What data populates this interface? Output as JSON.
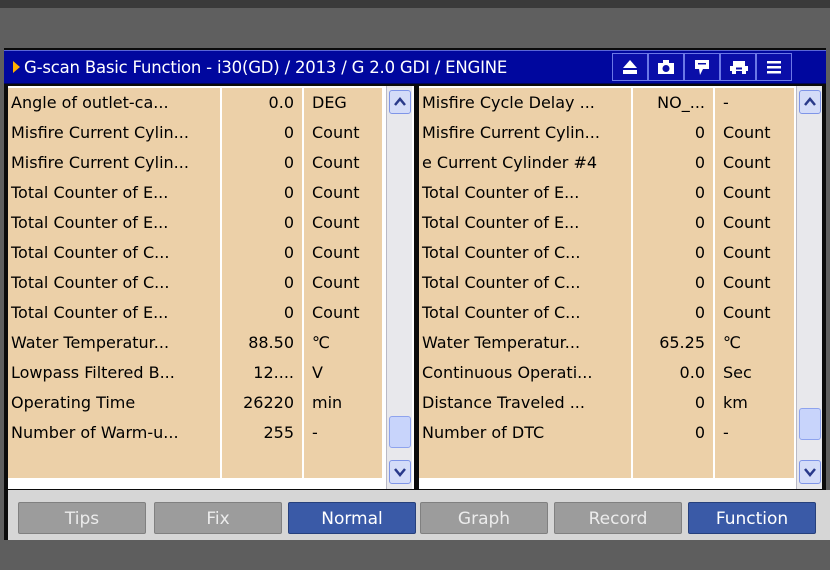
{
  "window": {
    "title": "G-scan Basic Function - i30(GD) / 2013 / G 2.0 GDI / ENGINE"
  },
  "toolbar": {
    "icons": [
      "eject-icon",
      "camera-icon",
      "comment-icon",
      "car-icon",
      "menu-icon"
    ]
  },
  "left_table": {
    "rows": [
      {
        "name": "Angle of outlet-ca...",
        "value": "0.0",
        "unit": "DEG"
      },
      {
        "name": "Misfire Current Cylin...",
        "value": "0",
        "unit": "Count"
      },
      {
        "name": "Misfire Current Cylin...",
        "value": "0",
        "unit": "Count"
      },
      {
        "name": "Total Counter of E...",
        "value": "0",
        "unit": "Count"
      },
      {
        "name": "Total Counter of E...",
        "value": "0",
        "unit": "Count"
      },
      {
        "name": "Total Counter of C...",
        "value": "0",
        "unit": "Count"
      },
      {
        "name": "Total Counter of C...",
        "value": "0",
        "unit": "Count"
      },
      {
        "name": "Total Counter of E...",
        "value": "0",
        "unit": "Count"
      },
      {
        "name": "Water Temperatur...",
        "value": "88.50",
        "unit": "℃"
      },
      {
        "name": "Lowpass Filtered B...",
        "value": "12....",
        "unit": "V"
      },
      {
        "name": "Operating Time",
        "value": "26220",
        "unit": "min"
      },
      {
        "name": "Number of Warm-u...",
        "value": "255",
        "unit": "-"
      },
      {
        "name": "",
        "value": "",
        "unit": ""
      }
    ]
  },
  "right_table": {
    "rows": [
      {
        "name": "Misfire Cycle Delay ...",
        "value": "NO_...",
        "unit": "-"
      },
      {
        "name": "Misfire Current Cylin...",
        "value": "0",
        "unit": "Count"
      },
      {
        "name": "e Current Cylinder #4",
        "value": "0",
        "unit": "Count"
      },
      {
        "name": "Total Counter of E...",
        "value": "0",
        "unit": "Count"
      },
      {
        "name": "Total Counter of E...",
        "value": "0",
        "unit": "Count"
      },
      {
        "name": "Total Counter of C...",
        "value": "0",
        "unit": "Count"
      },
      {
        "name": "Total Counter of C...",
        "value": "0",
        "unit": "Count"
      },
      {
        "name": "Total Counter of C...",
        "value": "0",
        "unit": "Count"
      },
      {
        "name": "Water Temperatur...",
        "value": "65.25",
        "unit": "℃"
      },
      {
        "name": "Continuous Operati...",
        "value": "0.0",
        "unit": "Sec"
      },
      {
        "name": "Distance Traveled ...",
        "value": "0",
        "unit": "km"
      },
      {
        "name": "Number of DTC",
        "value": "0",
        "unit": "-"
      },
      {
        "name": "",
        "value": "",
        "unit": ""
      }
    ]
  },
  "buttons": {
    "tips": "Tips",
    "fix": "Fix",
    "normal": "Normal",
    "graph": "Graph",
    "record": "Record",
    "function": "Function"
  },
  "colors": {
    "title_bg": "#00079e",
    "row_bg": "#ecd0a8",
    "active_button": "#3a5aa7",
    "inactive_button": "#9c9c9c"
  }
}
